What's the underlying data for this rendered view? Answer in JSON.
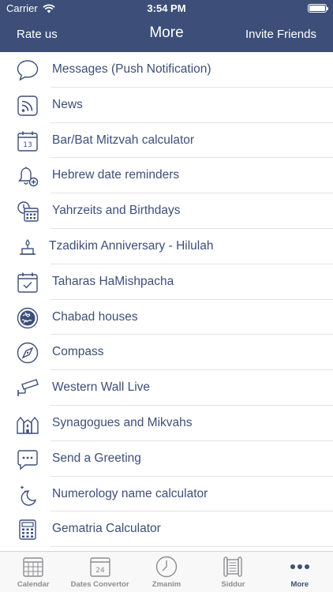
{
  "status": {
    "carrier": "Carrier",
    "time": "3:54 PM"
  },
  "nav": {
    "left": "Rate us",
    "title": "More",
    "right": "Invite Friends"
  },
  "items": [
    {
      "label": "Messages (Push Notification)",
      "icon": "speech-bubble-icon"
    },
    {
      "label": "News",
      "icon": "rss-icon"
    },
    {
      "label": "Bar/Bat Mitzvah calculator",
      "icon": "calendar-icon",
      "icon_text": "13"
    },
    {
      "label": "Hebrew date reminders",
      "icon": "bell-plus-icon"
    },
    {
      "label": "Yahrzeits and Birthdays",
      "icon": "clock-calendar-icon"
    },
    {
      "label": "Tzadikim Anniversary - Hilulah",
      "icon": "candle-icon"
    },
    {
      "label": "Taharas HaMishpacha",
      "icon": "calendar-check-icon"
    },
    {
      "label": "Chabad houses",
      "icon": "globe-icon"
    },
    {
      "label": "Compass",
      "icon": "compass-icon"
    },
    {
      "label": "Western Wall Live",
      "icon": "camera-icon"
    },
    {
      "label": "Synagogues and Mikvahs",
      "icon": "synagogue-icon"
    },
    {
      "label": "Send a Greeting",
      "icon": "chat-dots-icon"
    },
    {
      "label": "Numerology name calculator",
      "icon": "moon-stars-icon"
    },
    {
      "label": "Gematria Calculator",
      "icon": "calculator-icon"
    }
  ],
  "tabs": [
    {
      "label": "Calendar",
      "icon": "calendar-grid-icon"
    },
    {
      "label": "Dates Convertor",
      "icon": "calendar-day-icon",
      "icon_text": "24"
    },
    {
      "label": "Zmanim",
      "icon": "clock-icon"
    },
    {
      "label": "Siddur",
      "icon": "scroll-icon"
    },
    {
      "label": "More",
      "icon": "more-dots-icon"
    }
  ],
  "colors": {
    "brand": "#3d4f78",
    "tab_inactive": "#8e8e93",
    "separator": "#e3e3e6"
  }
}
